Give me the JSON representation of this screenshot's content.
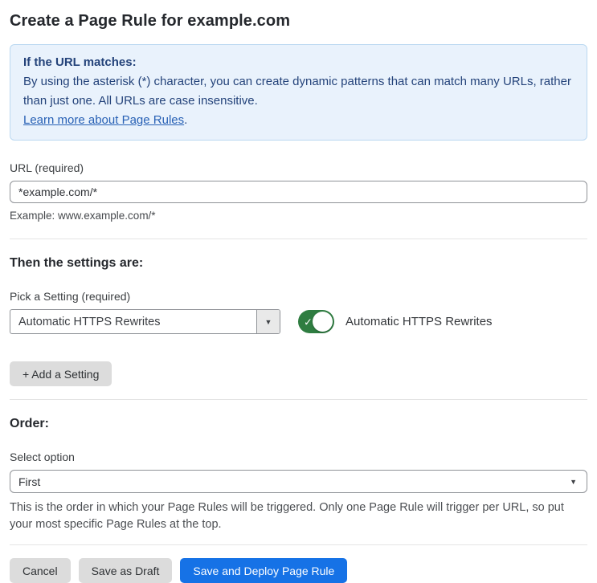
{
  "page": {
    "title": "Create a Page Rule for example.com"
  },
  "info_box": {
    "heading": "If the URL matches:",
    "body": "By using the asterisk (*) character, you can create dynamic patterns that can match many URLs, rather than just one. All URLs are case insensitive.",
    "link_label": "Learn more about Page Rules",
    "link_suffix": "."
  },
  "url_field": {
    "label": "URL (required)",
    "value": "*example.com/*",
    "example": "Example: www.example.com/*"
  },
  "settings_section": {
    "heading": "Then the settings are:",
    "pick_label": "Pick a Setting (required)",
    "selected_setting": "Automatic HTTPS Rewrites",
    "dropdown_arrow": "▼",
    "toggle_state": "on",
    "toggle_check": "✓",
    "toggle_label": "Automatic HTTPS Rewrites",
    "add_button_label": "+ Add a Setting"
  },
  "order_section": {
    "heading": "Order:",
    "select_label": "Select option",
    "selected_option": "First",
    "select_chevron": "▼",
    "help": "This is the order in which your Page Rules will be triggered. Only one Page Rule will trigger per URL, so put your most specific Page Rules at the top."
  },
  "footer": {
    "cancel_label": "Cancel",
    "save_draft_label": "Save as Draft",
    "save_deploy_label": "Save and Deploy Page Rule"
  },
  "colors": {
    "accent_blue": "#1672e6",
    "info_background": "#e9f2fc",
    "info_border": "#bad8f1",
    "info_text": "#24437a",
    "link_blue": "#2861b5",
    "toggle_green": "#2f7d41",
    "gray_button": "#dcdcdc"
  }
}
